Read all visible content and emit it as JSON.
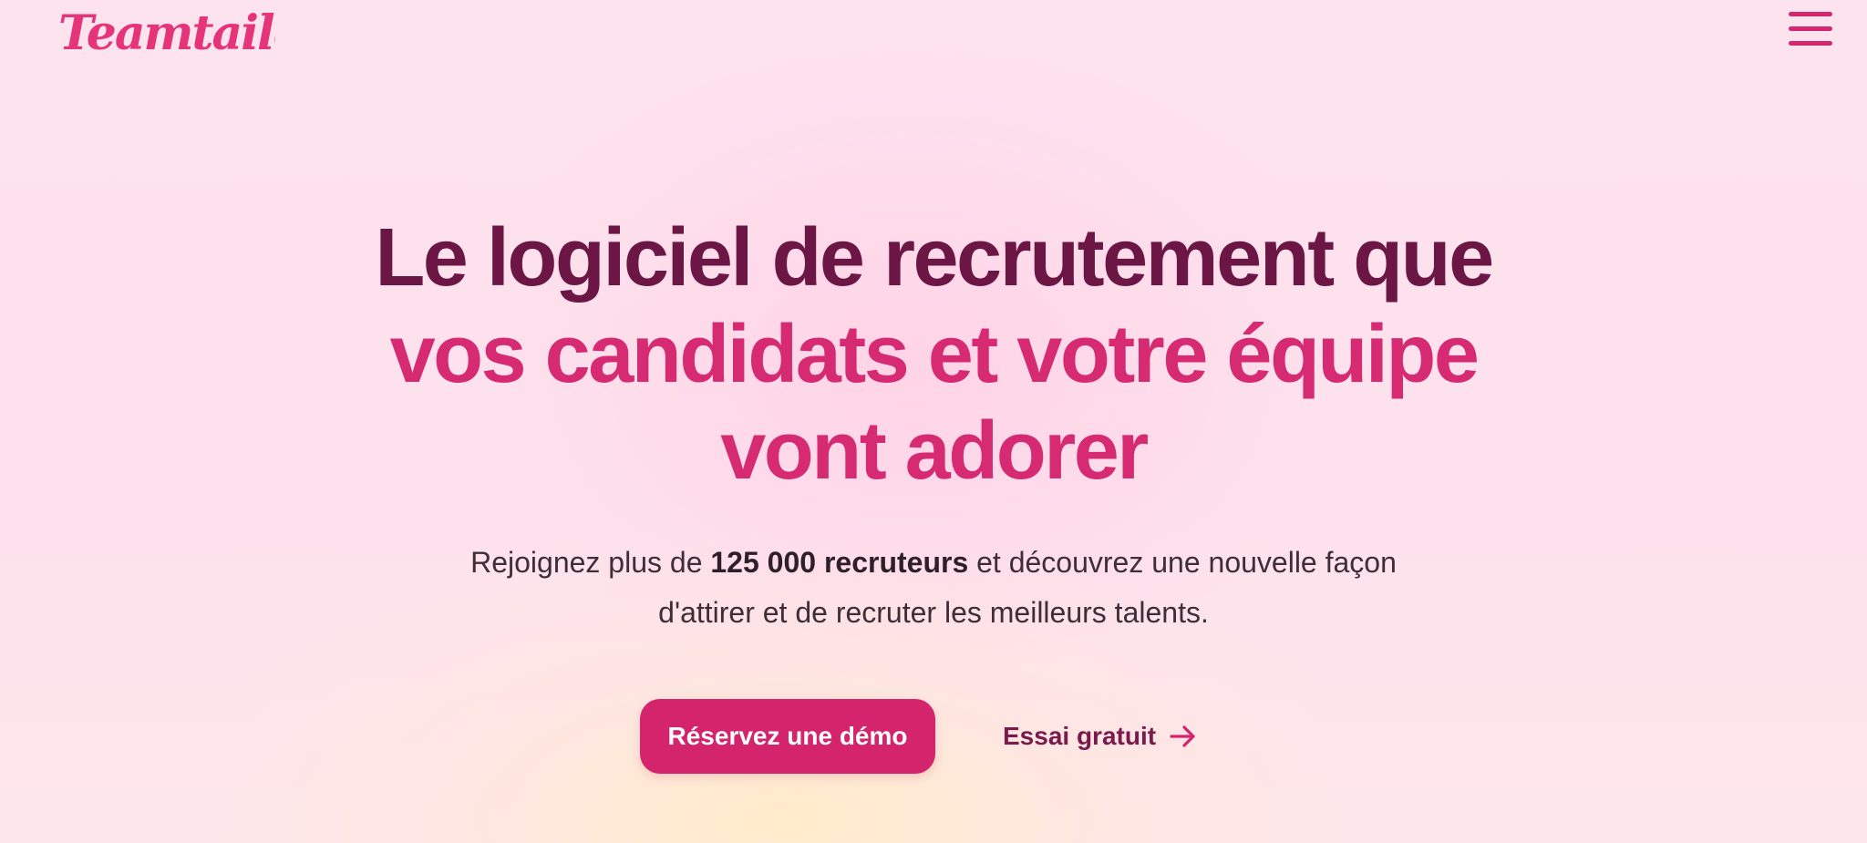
{
  "header": {
    "logo_text": "Teamtailor",
    "menu_icon": "hamburger-menu-icon"
  },
  "hero": {
    "title_line1": "Le logiciel de recrutement que",
    "title_line2": "vos candidats et votre équipe",
    "title_line3": "vont adorer",
    "subtitle_prefix": "Rejoignez plus de ",
    "subtitle_bold": "125 000 recruteurs",
    "subtitle_suffix": " et découvrez une nouvelle façon",
    "subtitle_line2": "d'attirer et de recruter les meilleurs talents."
  },
  "cta": {
    "demo_label": "Réservez une démo",
    "trial_label": "Essai gratuit",
    "trial_icon": "arrow-right-icon"
  },
  "colors": {
    "brand_pink": "#d4246c",
    "title_dark": "#6b1644",
    "title_pink": "#d62a72",
    "link_color": "#7a1a4c"
  }
}
